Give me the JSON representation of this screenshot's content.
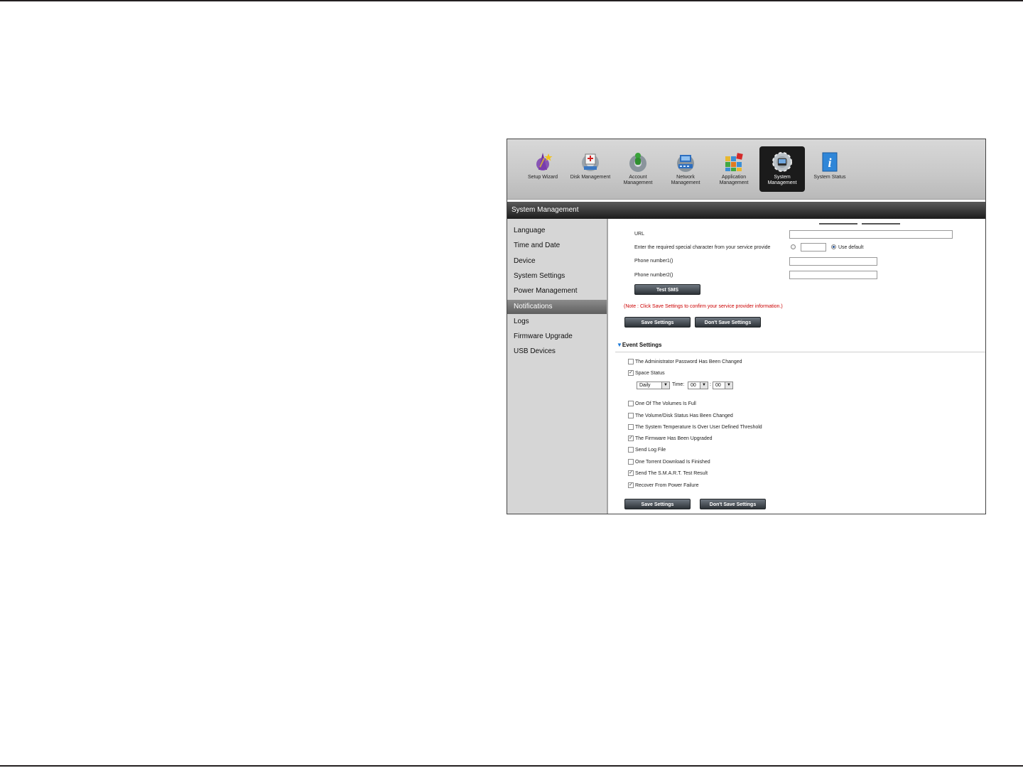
{
  "nav": {
    "items": [
      {
        "label": "Setup Wizard",
        "icon": "wizard-icon"
      },
      {
        "label": "Disk Management",
        "icon": "disk-icon"
      },
      {
        "label": "Account Management",
        "icon": "account-icon"
      },
      {
        "label": "Network Management",
        "icon": "network-icon"
      },
      {
        "label": "Application Management",
        "icon": "application-icon"
      },
      {
        "label": "System Management",
        "icon": "gear-icon"
      },
      {
        "label": "System Status",
        "icon": "info-icon"
      }
    ],
    "active": "System Management"
  },
  "title": "System Management",
  "sidebar": {
    "items": [
      "Language",
      "Time and Date",
      "Device",
      "System Settings",
      "Power Management",
      "Notifications",
      "Logs",
      "Firmware Upgrade",
      "USB Devices"
    ],
    "active": "Notifications"
  },
  "sms": {
    "url_label": "URL",
    "url_value": "",
    "special_char_label": "Enter the required special character from your service provide",
    "special_char_value": "",
    "use_default_label": "Use default",
    "phone1_label": "Phone number1()",
    "phone1_value": "",
    "phone2_label": "Phone number2()",
    "phone2_value": "",
    "test_button": "Test SMS",
    "note": "(Note : Click Save Settings to confirm your service provider information.)",
    "save_button": "Save Settings",
    "dont_save_button": "Don't Save Settings"
  },
  "events": {
    "title": "Event Settings",
    "items": [
      {
        "label": "The Administrator Password Has Been Changed",
        "checked": false
      },
      {
        "label": "Space Status",
        "checked": true
      },
      {
        "label": "One Of The Volumes Is Full",
        "checked": false
      },
      {
        "label": "The Volume/Disk Status Has Been Changed",
        "checked": false
      },
      {
        "label": "The System Temperature Is Over User Defined Threshold",
        "checked": false
      },
      {
        "label": "The Firmware Has Been Upgraded",
        "checked": true
      },
      {
        "label": "Send Log File",
        "checked": false
      },
      {
        "label": "One Torrent Download Is Finished",
        "checked": false
      },
      {
        "label": "Send The S.M.A.R.T. Test Result",
        "checked": true
      },
      {
        "label": "Recover From Power Failure",
        "checked": true
      }
    ],
    "frequency": "Daily",
    "time_label": "Time:",
    "hour": "00",
    "minute": "00",
    "separator": ":",
    "save_button": "Save Settings",
    "dont_save_button": "Don't Save Settings"
  },
  "colors": {
    "accent": "#1e7ad8",
    "note": "#cc0000",
    "titlebar": "#1c1c1c"
  }
}
